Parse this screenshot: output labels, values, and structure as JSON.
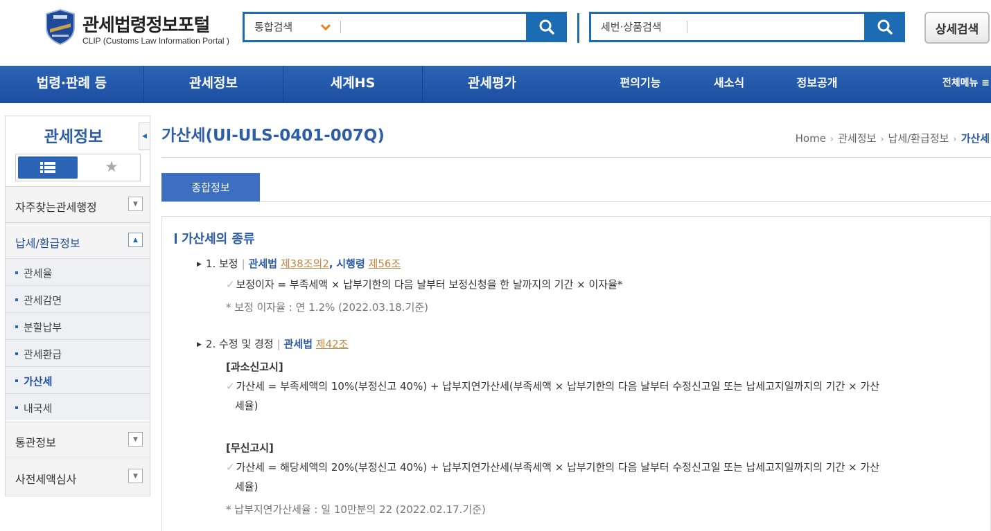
{
  "header": {
    "logo_title": "관세법령정보포털",
    "logo_sub": "CLIP (Customs Law Information Portal )",
    "search1": {
      "select_label": "통합검색",
      "value": ""
    },
    "search2": {
      "select_label": "세번·상품검색",
      "value": ""
    },
    "detail_search_label": "상세검색"
  },
  "nav": {
    "items": [
      "법령·판례 등",
      "관세정보",
      "세계HS",
      "관세평가"
    ],
    "small_items": [
      "편의기능",
      "새소식",
      "정보공개"
    ],
    "all_menu_label": "전체메뉴 ≡",
    "colors": {
      "bar": "#1c4fa0",
      "accent": "#1c6cb3"
    }
  },
  "sidebar": {
    "title": "관세정보",
    "sections": [
      {
        "label": "자주찾는관세행정",
        "open": false
      },
      {
        "label": "납세/환급정보",
        "open": true
      },
      {
        "label": "통관정보",
        "open": false
      },
      {
        "label": "사전세액심사",
        "open": false
      }
    ],
    "sub_items": [
      {
        "label": "관세율",
        "active": false
      },
      {
        "label": "관세감면",
        "active": false
      },
      {
        "label": "분할납부",
        "active": false
      },
      {
        "label": "관세환급",
        "active": false
      },
      {
        "label": "가산세",
        "active": true
      },
      {
        "label": "내국세",
        "active": false
      }
    ]
  },
  "main": {
    "title": "가산세(UI-ULS-0401-007Q)",
    "breadcrumb": [
      "Home",
      "관세정보",
      "납세/환급정보",
      "가산세"
    ],
    "tab_label": "종합정보",
    "section_title": "가산세의 종류",
    "item1": {
      "label": "1. 보정",
      "law1": "관세법",
      "link1": "제38조의2",
      "comma": ",",
      "law2": "시행령",
      "link2": "제56조",
      "formula": "보정이자 = 부족세액 × 납부기한의 다음 날부터 보정신청을 한 날까지의 기간 × 이자율*",
      "note": "* 보정 이자율 : 연 1.2% (2022.03.18.기준)"
    },
    "item2": {
      "label": "2. 수정 및 경정",
      "law1": "관세법",
      "link1": "제42조",
      "sub1_title": "[과소신고시]",
      "sub1_formula_line1": "가산세 = 부족세액의 10%(부정신고 40%) + 납부지연가산세(부족세액 × 납부기한의 다음 날부터 수정신고일 또는 납세고지일까지의 기간 × 가산",
      "sub1_formula_line2": "세율)",
      "sub2_title": "[무신고시]",
      "sub2_formula_line1": "가산세 = 해당세액의 20%(부정신고 40%) + 납부지연가산세(부족세액 × 납부기한의 다음 날부터 수정신고일 또는 납세고지일까지의 기간 × 가산",
      "sub2_formula_line2": "세율)",
      "note": "* 납부지연가산세율 : 일 10만분의 22 (2022.02.17.기준)"
    }
  }
}
